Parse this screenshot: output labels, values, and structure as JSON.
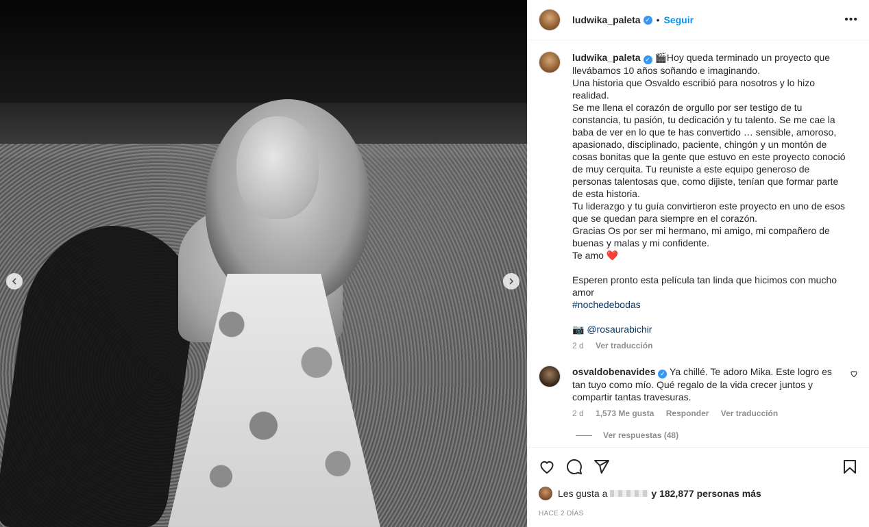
{
  "header": {
    "username": "ludwika_paleta",
    "verified_icon": "verified-badge-icon",
    "separator": "•",
    "follow_label": "Seguir",
    "more_label": "•••"
  },
  "caption": {
    "username": "ludwika_paleta",
    "emoji": "🎬",
    "lines": [
      "Hoy queda terminado un proyecto que llevábamos 10 años soñando e imaginando.",
      "Una historia que Osvaldo escribió para nosotros y lo hizo realidad.",
      "Se me llena el corazón de orgullo por ser testigo de tu constancia, tu pasión, tu dedicación y tu talento. Se me cae la baba de ver en lo que te has convertido … sensible, amoroso, apasionado, disciplinado, paciente, chingón y un montón de cosas bonitas que la gente que estuvo en este proyecto conoció de muy cerquita. Tu reuniste a este equipo generoso de personas talentosas que, como dijiste, tenían que formar parte de esta historia.",
      "Tu liderazgo y tu guía convirtieron este proyecto en uno de esos que se quedan para siempre en el corazón.",
      "Gracias Os por ser mi hermano, mi amigo, mi compañero de buenas y malas y mi confidente.",
      "Te amo ❤️"
    ],
    "closing": "Esperen pronto esta película tan linda que hicimos con mucho amor",
    "hashtag": "#nochedebodas",
    "camera_emoji": "📷",
    "credit": "@rosaurabichir",
    "time": "2 d",
    "translate": "Ver traducción"
  },
  "comment": {
    "username": "osvaldobenavides",
    "text": "Ya chillé. Te adoro Mika. Este logro es tan tuyo como mío. Qué regalo de la vida crecer juntos y compartir tantas travesuras.",
    "time": "2 d",
    "likes": "1,573 Me gusta",
    "reply": "Responder",
    "translate": "Ver traducción",
    "view_replies": "Ver respuestas (48)"
  },
  "likes": {
    "prefix": "Les gusta a",
    "suffix": "y 182,877 personas más"
  },
  "date": "HACE 2 DÍAS",
  "icons": [
    "heart-icon",
    "comment-icon",
    "share-icon",
    "bookmark-icon",
    "chevron-left-icon",
    "chevron-right-icon"
  ]
}
